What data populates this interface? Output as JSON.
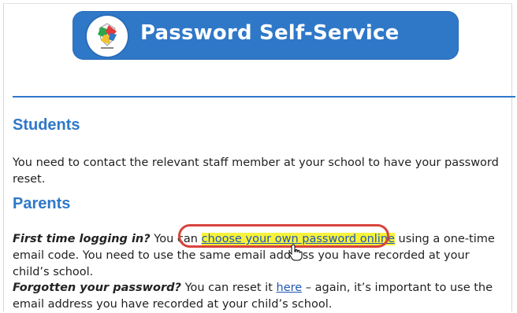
{
  "header": {
    "title": "Password Self-Service",
    "logo_icon": "school-crest-icon"
  },
  "students": {
    "heading": "Students",
    "text": "You need to contact the relevant staff member at your school to have your password reset."
  },
  "parents": {
    "heading": "Parents",
    "first_time": {
      "question": "First time logging in?",
      "before_link": " You can ",
      "link_text": "choose your own password online",
      "after_link": " using a one-time email code. You need to use the same email address you have recorded at your child’s school."
    },
    "forgotten": {
      "question": "Forgotten your password?",
      "before_link": " You can reset it ",
      "link_text": "here",
      "after_link": " – again, it’s important to use the email address you have recorded at your child’s school."
    }
  },
  "colors": {
    "brand_blue": "#2f78c8",
    "link_blue": "#1f56b8",
    "highlight_yellow": "#f7f23a",
    "annotation_red": "#d8443c"
  }
}
